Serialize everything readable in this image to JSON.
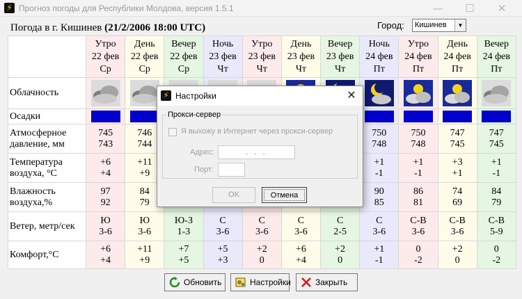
{
  "window": {
    "title": "Прогноз погоды для Республики Молдова, версия 1.5.1",
    "minimize": "—",
    "maximize": "☐",
    "close": "✕"
  },
  "header": {
    "prefix": "Погода в г. Кишинев",
    "datetime": "(21/2/2006 18:00 UTC)",
    "city_label": "Город:",
    "city_value": "Кишинев"
  },
  "row_labels": {
    "clouds": "Облачность",
    "precip": "Осадки",
    "pressure": "Атмосферное давление, мм",
    "temperature": "Температура воздуха, °С",
    "humidity": "Влажность воздуха,%",
    "wind": "Ветер, метр/сек",
    "comfort": "Комфорт,°С"
  },
  "columns": [
    {
      "period": "Утро",
      "date": "22 фев",
      "weekday": "Ср",
      "type": "morning",
      "cloud_icon": "cloudy-icon"
    },
    {
      "period": "День",
      "date": "22 фев",
      "weekday": "Ср",
      "type": "day",
      "cloud_icon": "cloudy-icon"
    },
    {
      "period": "Вечер",
      "date": "22 фев",
      "weekday": "Ср",
      "type": "evening",
      "cloud_icon": "cloudy-icon"
    },
    {
      "period": "Ночь",
      "date": "23 фев",
      "weekday": "Чт",
      "type": "night",
      "cloud_icon": "cloudy-icon"
    },
    {
      "period": "Утро",
      "date": "23 фев",
      "weekday": "Чт",
      "type": "morning",
      "cloud_icon": "cloudy-icon"
    },
    {
      "period": "День",
      "date": "23 фев",
      "weekday": "Чт",
      "type": "day",
      "cloud_icon": "sun-cloud-icon"
    },
    {
      "period": "Вечер",
      "date": "23 фев",
      "weekday": "Чт",
      "type": "evening",
      "cloud_icon": "moon-cloud-icon"
    },
    {
      "period": "Ночь",
      "date": "24 фев",
      "weekday": "Пт",
      "type": "night",
      "cloud_icon": "moon-cloud-icon"
    },
    {
      "period": "Утро",
      "date": "24 фев",
      "weekday": "Пт",
      "type": "morning",
      "cloud_icon": "sun-cloud-icon"
    },
    {
      "period": "День",
      "date": "24 фев",
      "weekday": "Пт",
      "type": "day",
      "cloud_icon": "sun-cloud-icon"
    },
    {
      "period": "Вечер",
      "date": "24 фев",
      "weekday": "Пт",
      "type": "evening",
      "cloud_icon": "cloudy-icon"
    }
  ],
  "rows": {
    "pressure": [
      [
        "745",
        "743"
      ],
      [
        "746",
        "744"
      ],
      [
        "",
        ""
      ],
      [
        "",
        ""
      ],
      [
        "",
        ""
      ],
      [
        "",
        ""
      ],
      [
        "",
        ""
      ],
      [
        "750",
        "748"
      ],
      [
        "750",
        "748"
      ],
      [
        "747",
        "745"
      ],
      [
        "747",
        "745"
      ]
    ],
    "temperature": [
      [
        "+6",
        "+4"
      ],
      [
        "+11",
        "+9"
      ],
      [
        "",
        ""
      ],
      [
        "",
        ""
      ],
      [
        "",
        ""
      ],
      [
        "",
        ""
      ],
      [
        "",
        ""
      ],
      [
        "+1",
        "-1"
      ],
      [
        "+1",
        "-1"
      ],
      [
        "+3",
        "+1"
      ],
      [
        "+1",
        "-1"
      ]
    ],
    "humidity": [
      [
        "97",
        "92"
      ],
      [
        "84",
        "79"
      ],
      [
        "",
        ""
      ],
      [
        "",
        ""
      ],
      [
        "",
        ""
      ],
      [
        "",
        ""
      ],
      [
        "",
        ""
      ],
      [
        "90",
        "85"
      ],
      [
        "86",
        "81"
      ],
      [
        "74",
        "69"
      ],
      [
        "84",
        "79"
      ]
    ],
    "wind": [
      [
        "Ю",
        "3-6"
      ],
      [
        "Ю",
        "3-6"
      ],
      [
        "Ю-З",
        "1-3"
      ],
      [
        "С",
        "3-6"
      ],
      [
        "С",
        "3-6"
      ],
      [
        "С",
        "3-6"
      ],
      [
        "С",
        "2-5"
      ],
      [
        "С",
        "3-6"
      ],
      [
        "С-В",
        "3-6"
      ],
      [
        "С-В",
        "3-6"
      ],
      [
        "С-В",
        "5-9"
      ]
    ],
    "comfort": [
      [
        "+6",
        "+4"
      ],
      [
        "+11",
        "+9"
      ],
      [
        "+7",
        "+5"
      ],
      [
        "+5",
        "+3"
      ],
      [
        "+2",
        "0"
      ],
      [
        "+6",
        "+4"
      ],
      [
        "+2",
        "0"
      ],
      [
        "+1",
        "-1"
      ],
      [
        "0",
        "-2"
      ],
      [
        "+2",
        "0"
      ],
      [
        "0",
        "-2"
      ]
    ]
  },
  "precip_color": "#0000cc",
  "buttons": {
    "refresh": "Обновить",
    "settings": "Настройки",
    "close": "Закрыть"
  },
  "dialog": {
    "title": "Настройки",
    "group_title": "Прокси-сервер",
    "proxy_checkbox": "Я выхожу в Интернет через прокси-сервер",
    "proxy_checked": false,
    "address_label": "Адрес:",
    "address_value": ". . .",
    "port_label": "Порт:",
    "port_value": "",
    "ok": "OK",
    "cancel": "Отмена"
  },
  "colors": {
    "morning": "#fdeaea",
    "day": "#fffdea",
    "evening": "#e5f6e3",
    "night": "#e9e9fb",
    "app_icon_bg": "#111111",
    "app_icon_fg": "#f5d000"
  }
}
